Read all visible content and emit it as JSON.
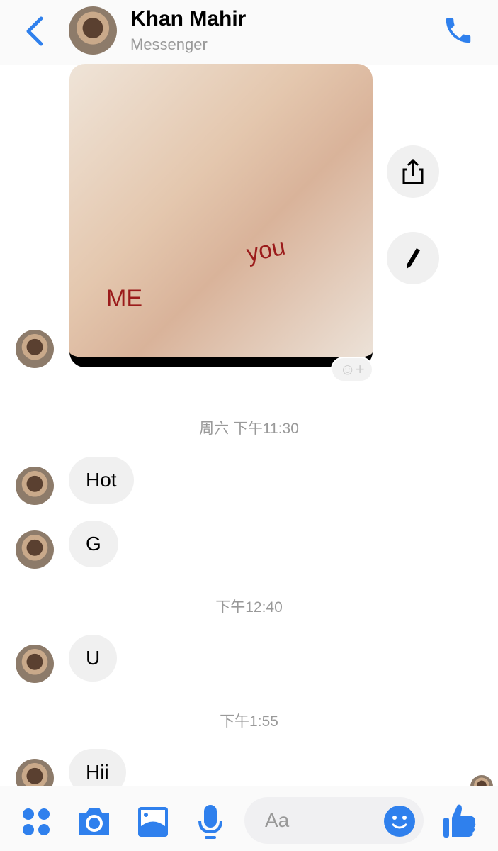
{
  "header": {
    "title": "Khan Mahir",
    "subtitle": "Messenger"
  },
  "image_message": {
    "label_left": "ME",
    "label_right": "you"
  },
  "messages": [
    {
      "type": "timestamp",
      "text": "周六 下午11:30"
    },
    {
      "type": "bubble",
      "text": "Hot"
    },
    {
      "type": "bubble",
      "text": "G"
    },
    {
      "type": "timestamp",
      "text": "下午12:40"
    },
    {
      "type": "bubble",
      "text": "U"
    },
    {
      "type": "timestamp",
      "text": "下午1:55"
    },
    {
      "type": "bubble",
      "text": "Hii"
    }
  ],
  "composer": {
    "placeholder": "Aa"
  },
  "colors": {
    "accent": "#2f80ed"
  }
}
